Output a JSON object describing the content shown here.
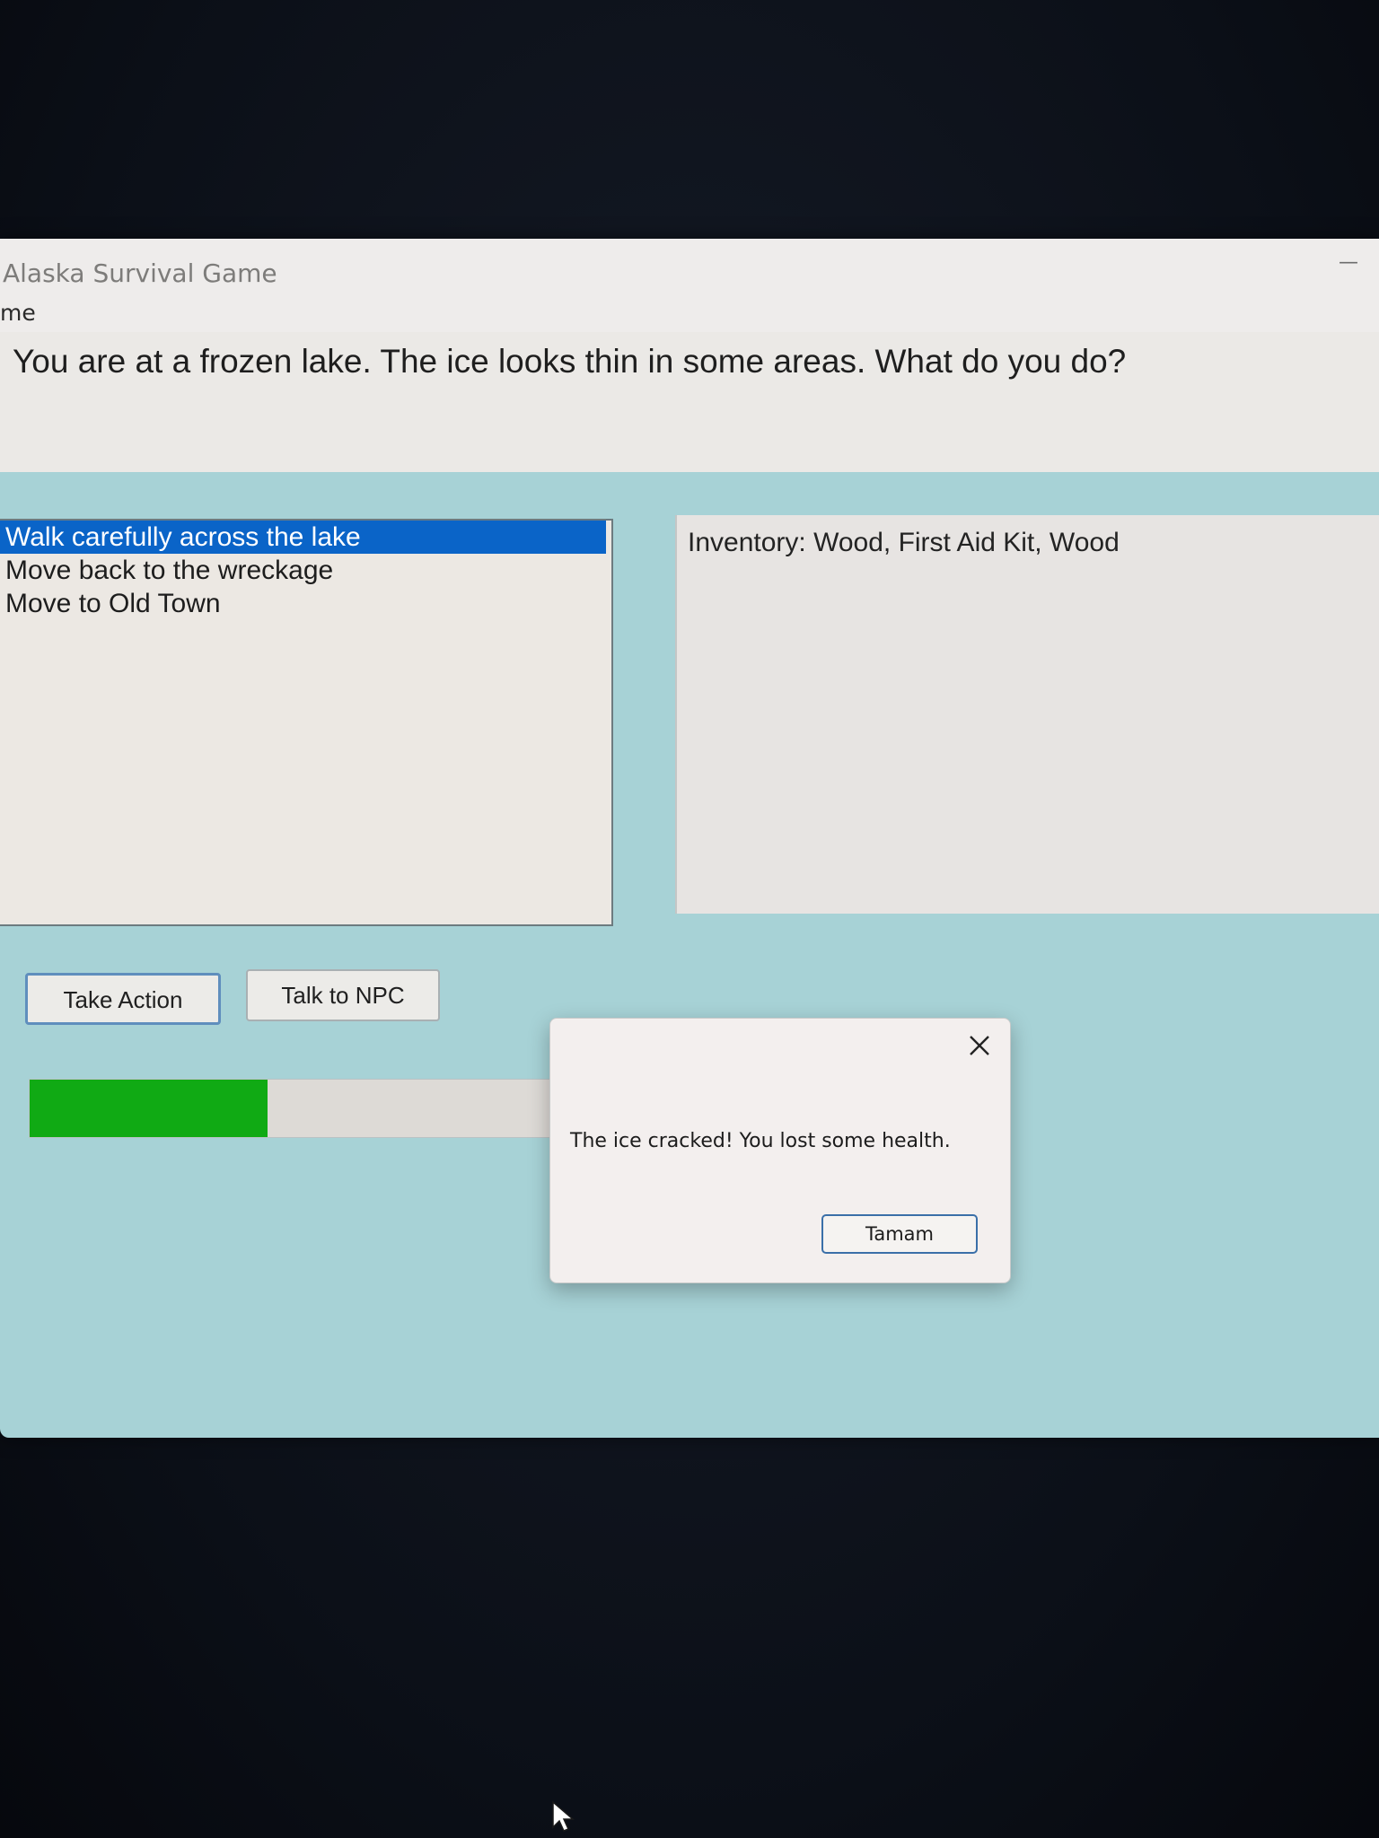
{
  "window": {
    "title": "Alaska Survival Game",
    "minimize_icon": "minimize-icon"
  },
  "menu": {
    "items": [
      {
        "label": "me"
      }
    ]
  },
  "story": {
    "text": "You are at a frozen lake. The ice looks thin in some areas. What do you do?"
  },
  "actions": {
    "items": [
      {
        "label": "Walk carefully across the lake",
        "selected": true
      },
      {
        "label": "Move back to the wreckage",
        "selected": false
      },
      {
        "label": "Move to Old Town",
        "selected": false
      }
    ]
  },
  "inventory": {
    "text": "Inventory: Wood, First Aid Kit, Wood"
  },
  "buttons": {
    "take_action": "Take Action",
    "talk_npc": "Talk to NPC"
  },
  "health": {
    "fraction": 0.4,
    "color": "#10aa14"
  },
  "dialog": {
    "message": "The ice cracked! You lost some health.",
    "ok_label": "Tamam",
    "close_icon": "close-icon"
  },
  "colors": {
    "window_bg": "#a7d2d6",
    "selection": "#0a64c8",
    "dialog_button_border": "#3a6fa8"
  }
}
